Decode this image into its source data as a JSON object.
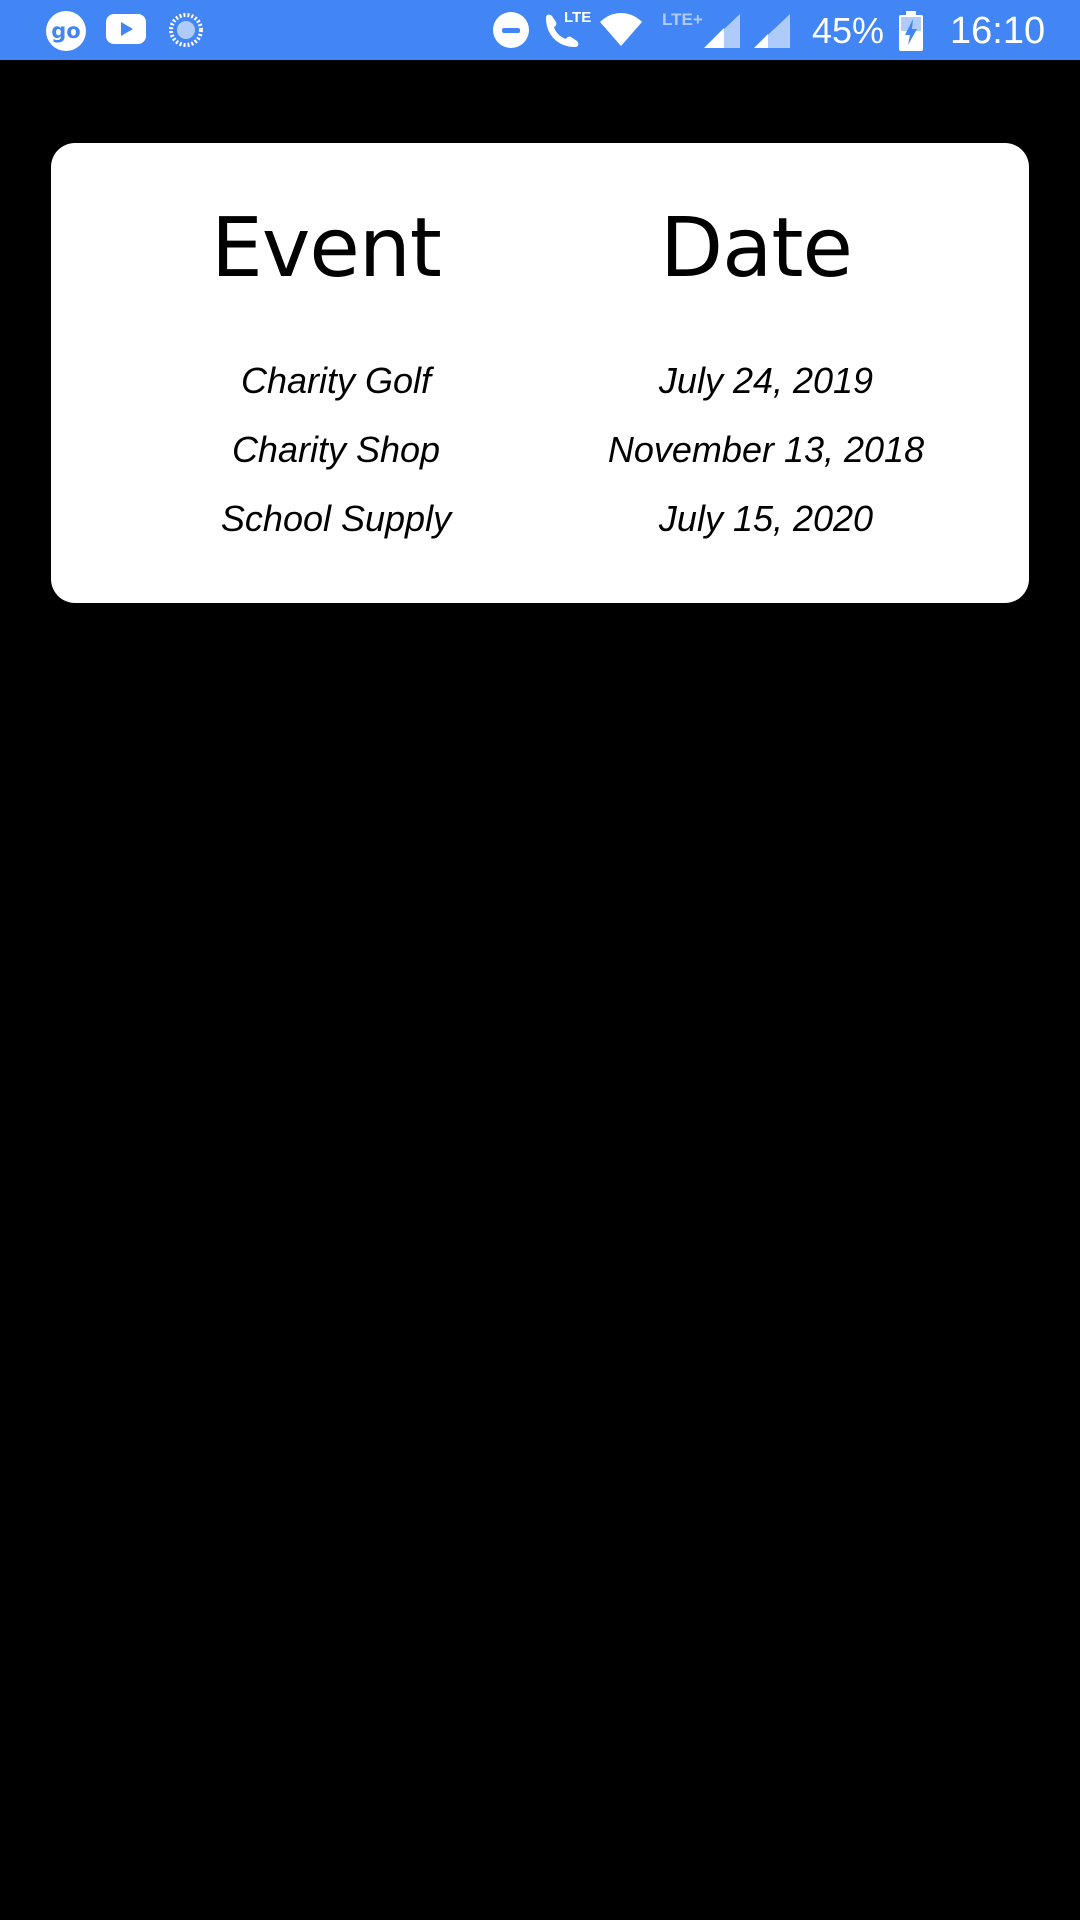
{
  "status_bar": {
    "go_label": "go",
    "phone_lte_label": "LTE",
    "lte_plus_label": "LTE+",
    "battery": "45%",
    "time": "16:10",
    "icons": [
      "go-icon",
      "youtube-icon",
      "dots-icon",
      "do-not-disturb-icon",
      "phone-lte-icon",
      "wifi-icon",
      "lte-plus-signal-icon",
      "signal-icon",
      "battery-charging-icon"
    ]
  },
  "table": {
    "headers": {
      "event": "Event",
      "date": "Date"
    },
    "rows": [
      {
        "event": "Charity Golf",
        "date": "July 24, 2019"
      },
      {
        "event": "Charity Shop",
        "date": "November 13, 2018"
      },
      {
        "event": "School Supply",
        "date": "July 15, 2020"
      }
    ]
  },
  "colors": {
    "status_bar": "#4285f4",
    "background": "#000000",
    "card": "#ffffff"
  }
}
